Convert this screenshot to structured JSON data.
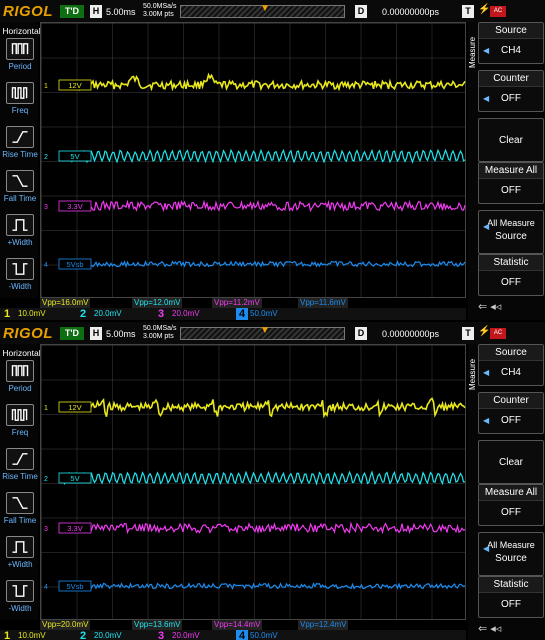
{
  "screens": [
    {
      "brand": "RIGOL",
      "trigger_status": "T'D",
      "horizontal_label": "H",
      "timebase": "5.00ms",
      "sample_rate": "50.0MSa/s",
      "memory_depth": "3.00M pts",
      "delay_label": "D",
      "delay_value": "0.00000000ps",
      "trigger_label": "T",
      "trigger_coupling": "AC",
      "left_panel": {
        "title": "Horizontal",
        "items": [
          "Period",
          "Freq",
          "Rise Time",
          "Fall Time",
          "+Width",
          "-Width"
        ]
      },
      "channels": [
        {
          "num": "1",
          "name": "12V",
          "color": "#e8e81c",
          "vpp": "Vpp=16.0mV",
          "scale": "10.0mV"
        },
        {
          "num": "2",
          "name": "5V",
          "color": "#1ee6ef",
          "vpp": "Vpp=12.0mV",
          "scale": "20.0mV"
        },
        {
          "num": "3",
          "name": "3.3V",
          "color": "#f03cf0",
          "vpp": "Vpp=11.2mV",
          "scale": "20.0mV"
        },
        {
          "num": "4",
          "name": "5Vsb",
          "color": "#1c8cf0",
          "vpp": "Vpp=11.6mV",
          "scale": "50.0mV"
        }
      ],
      "right_panel": {
        "title": "Measure",
        "source_label": "Source",
        "source_value": "CH4",
        "counter_label": "Counter",
        "counter_value": "OFF",
        "clear_label": "Clear",
        "measure_all_label": "Measure All",
        "measure_all_value": "OFF",
        "all_measure_label": "All Measure",
        "all_measure_value": "Source",
        "statistic_label": "Statistic",
        "statistic_value": "OFF"
      }
    },
    {
      "brand": "RIGOL",
      "trigger_status": "T'D",
      "horizontal_label": "H",
      "timebase": "5.00ms",
      "sample_rate": "50.0MSa/s",
      "memory_depth": "3.00M pts",
      "delay_label": "D",
      "delay_value": "0.00000000ps",
      "trigger_label": "T",
      "trigger_coupling": "AC",
      "left_panel": {
        "title": "Horizontal",
        "items": [
          "Period",
          "Freq",
          "Rise Time",
          "Fall Time",
          "+Width",
          "-Width"
        ]
      },
      "channels": [
        {
          "num": "1",
          "name": "12V",
          "color": "#e8e81c",
          "vpp": "Vpp=20.0mV",
          "scale": "10.0mV"
        },
        {
          "num": "2",
          "name": "5V",
          "color": "#1ee6ef",
          "vpp": "Vpp=13.6mV",
          "scale": "20.0mV"
        },
        {
          "num": "3",
          "name": "3.3V",
          "color": "#f03cf0",
          "vpp": "Vpp=14.4mV",
          "scale": "20.0mV"
        },
        {
          "num": "4",
          "name": "5Vsb",
          "color": "#1c8cf0",
          "vpp": "Vpp=12.4mV",
          "scale": "50.0mV"
        }
      ],
      "right_panel": {
        "title": "Measure",
        "source_label": "Source",
        "source_value": "CH4",
        "counter_label": "Counter",
        "counter_value": "OFF",
        "clear_label": "Clear",
        "measure_all_label": "Measure All",
        "measure_all_value": "OFF",
        "all_measure_label": "All Measure",
        "all_measure_value": "Source",
        "statistic_label": "Statistic",
        "statistic_value": "OFF"
      }
    }
  ]
}
